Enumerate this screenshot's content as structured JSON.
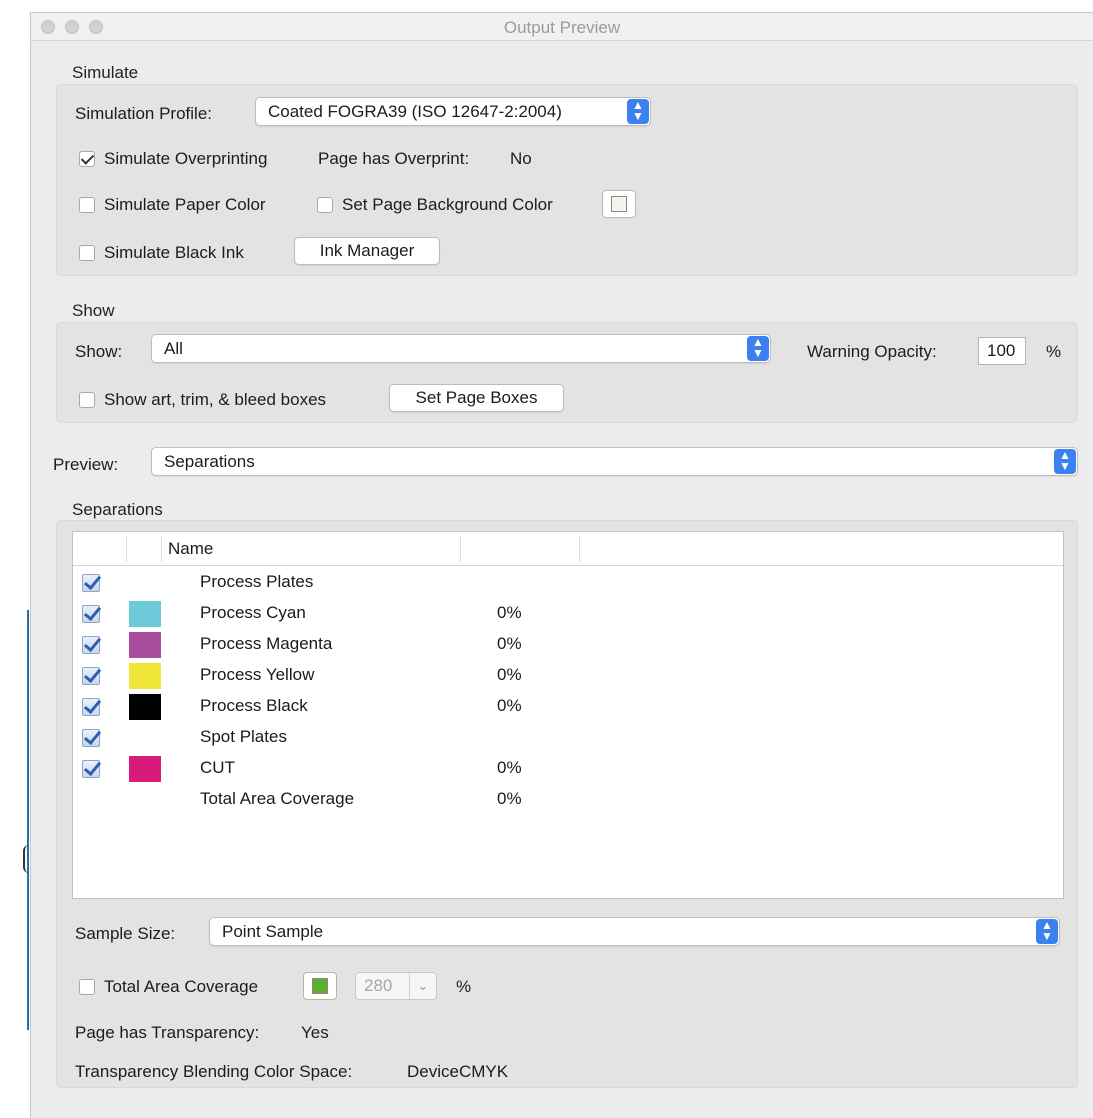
{
  "window": {
    "title": "Output Preview"
  },
  "simulate": {
    "section_label": "Simulate",
    "profile_label": "Simulation Profile:",
    "profile_value": "Coated FOGRA39 (ISO 12647-2:2004)",
    "simulate_overprinting": {
      "label": "Simulate Overprinting",
      "checked": true
    },
    "overprint_status_label": "Page has Overprint:",
    "overprint_status_value": "No",
    "simulate_paper_color": {
      "label": "Simulate Paper Color",
      "checked": false
    },
    "set_page_background": {
      "label": "Set Page Background Color",
      "checked": false
    },
    "simulate_black_ink": {
      "label": "Simulate Black Ink",
      "checked": false
    },
    "ink_manager_label": "Ink Manager"
  },
  "show": {
    "section_label": "Show",
    "show_label": "Show:",
    "show_value": "All",
    "warning_opacity_label": "Warning Opacity:",
    "warning_opacity_value": "100",
    "percent": "%",
    "show_boxes": {
      "label": "Show art, trim, & bleed boxes",
      "checked": false
    },
    "set_page_boxes_label": "Set Page Boxes"
  },
  "preview": {
    "label": "Preview:",
    "value": "Separations"
  },
  "separations": {
    "section_label": "Separations",
    "columns": [
      "",
      "",
      "Name",
      "",
      ""
    ],
    "rows": [
      {
        "name": "Process Plates",
        "checked": true,
        "swatch": "",
        "coverage": ""
      },
      {
        "name": "Process Cyan",
        "checked": true,
        "swatch": "#6ccad9",
        "coverage": "0%"
      },
      {
        "name": "Process Magenta",
        "checked": true,
        "swatch": "#a84c9c",
        "coverage": "0%"
      },
      {
        "name": "Process Yellow",
        "checked": true,
        "swatch": "#f0e63a",
        "coverage": "0%"
      },
      {
        "name": "Process Black",
        "checked": true,
        "swatch": "#000000",
        "coverage": "0%"
      },
      {
        "name": "Spot Plates",
        "checked": true,
        "swatch": "",
        "coverage": ""
      },
      {
        "name": "CUT",
        "checked": true,
        "swatch": "#d81b7a",
        "coverage": "0%"
      },
      {
        "name": "Total Area Coverage",
        "checked": false,
        "swatch": "",
        "coverage": "0%"
      }
    ],
    "sample_size_label": "Sample Size:",
    "sample_size_value": "Point Sample",
    "total_area_coverage": {
      "label": "Total Area Coverage",
      "checked": false
    },
    "tac_color": "#5aad2e",
    "tac_value": "280",
    "tac_percent": "%",
    "transparency_label": "Page has Transparency:",
    "transparency_value": "Yes",
    "blending_label": "Transparency Blending Color Space:",
    "blending_value": "DeviceCMYK"
  },
  "colors": {
    "accent": "#3b82f0",
    "panel": "#ececec",
    "group": "#e3e3e3"
  },
  "icons": {
    "popup": "chevron-updown-icon",
    "check": "checkmark-icon",
    "combo": "chevron-down-icon"
  }
}
